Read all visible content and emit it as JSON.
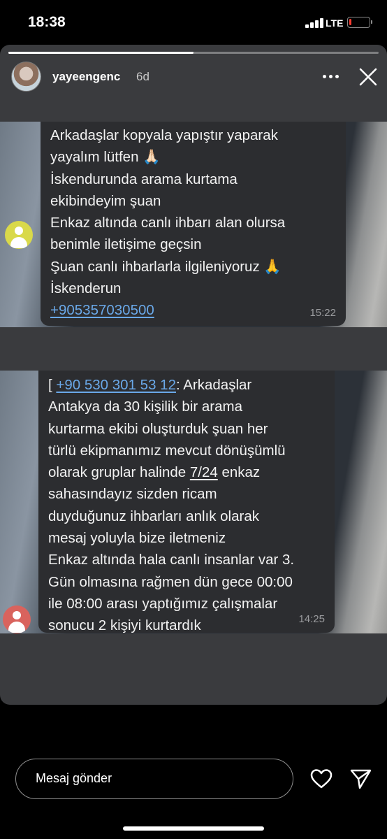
{
  "status_bar": {
    "time": "18:38",
    "network": "LTE",
    "battery_level": 0.1,
    "battery_color": "#ff3b30"
  },
  "story": {
    "username": "yayeengenc",
    "age": "6d",
    "progress": 0.5,
    "icons": [
      "more-icon",
      "close-icon"
    ]
  },
  "messages": [
    {
      "text": "Arkadaşlar kopyala yapıştır yaparak\nyayalım lütfen 🙏🏻\nİskendurunda arama kurtama\nekibindeyim şuan\nEnkaz altında canlı ihbarı alan olursa\nbenimle iletişime geçsin\nŞuan canlı ihbarlarla ilgileniyoruz 🙏\nİskenderun",
      "phone": "+905357030500",
      "time": "15:22",
      "avatar_color": "#d9d94a"
    },
    {
      "prefix": "[ ",
      "phone": "+90 530 301 53 12",
      "text_a": ": Arkadaşlar\nAntakya da 30 kişilik bir arama\nkurtarma ekibi oluşturduk şuan her\ntürlü ekipmanımız mevcut dönüşümlü\nolarak gruplar halinde ",
      "highlight": "7/24",
      "text_b": " enkaz\nsahasındayız sizden ricam\nduyduğunuz ihbarları anlık olarak\nmesaj yoluyla bize iletmeniz\n Enkaz altında hala canlı insanlar var 3.\nGün olmasına rağmen dün gece 00:00\nile 08:00 arası yaptığımız çalışmalar\nsonucu 2 kişiyi kurtardık",
      "time": "14:25",
      "avatar_color": "#d9635d"
    }
  ],
  "reply": {
    "placeholder": "Mesaj gönder"
  },
  "actions": {
    "icons": [
      "heart-icon",
      "send-icon"
    ]
  }
}
